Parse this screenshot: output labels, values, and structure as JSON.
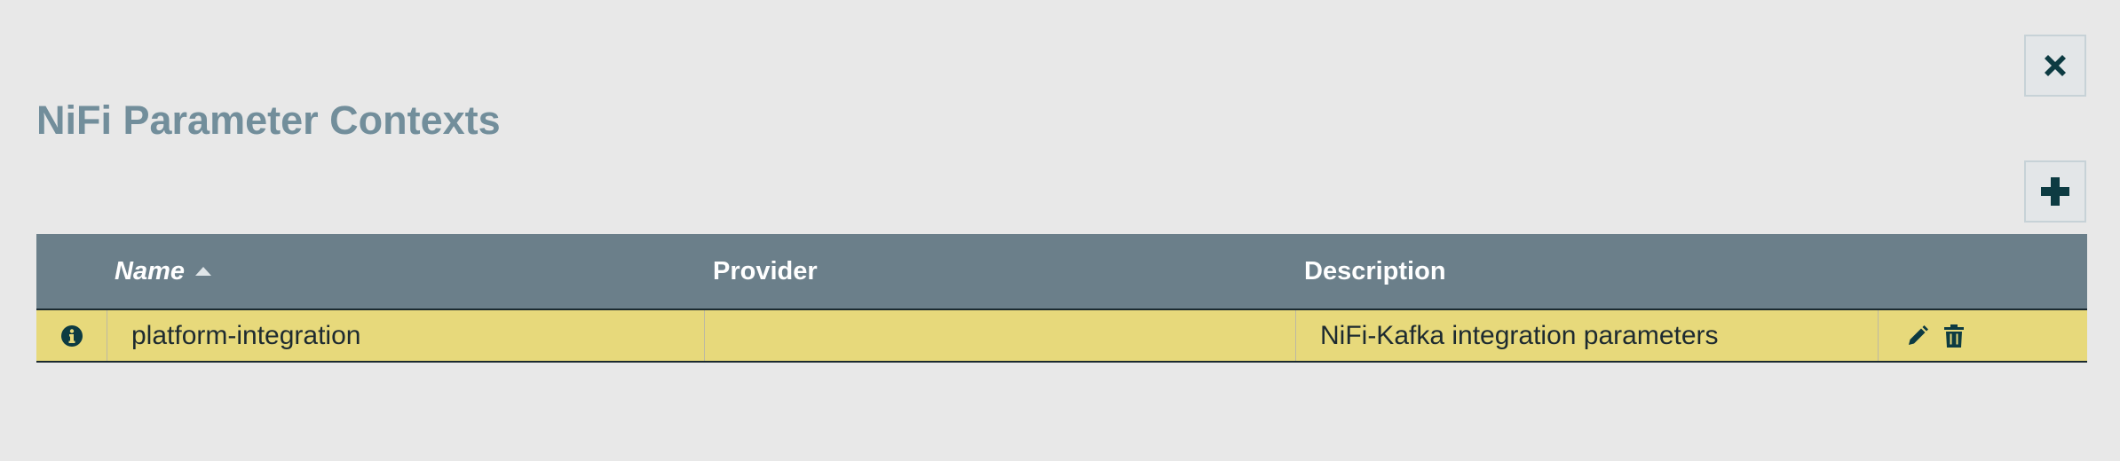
{
  "dialog": {
    "title": "NiFi Parameter Contexts",
    "close_icon": "close-icon",
    "add_icon": "plus-icon"
  },
  "table": {
    "columns": {
      "name": "Name",
      "provider": "Provider",
      "description": "Description"
    },
    "sort": {
      "column": "name",
      "direction": "ascending"
    },
    "rows": [
      {
        "info_icon": "info-icon",
        "name": "platform-integration",
        "provider": "",
        "description": "NiFi-Kafka integration parameters",
        "actions": [
          "edit-icon",
          "delete-icon"
        ]
      }
    ]
  },
  "colors": {
    "background": "#e8e8e8",
    "title": "#728e9b",
    "header_bg": "#6b7f8a",
    "selected_row": "#e7d97b",
    "icon": "#0d3b42"
  }
}
